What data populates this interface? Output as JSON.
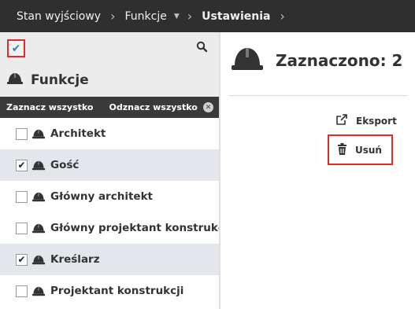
{
  "breadcrumb": {
    "items": [
      "Stan wyjściowy",
      "Funkcje",
      "Ustawienia"
    ]
  },
  "left_panel": {
    "title": "Funkcje",
    "select_all": "Zaznacz wszystko",
    "deselect_all": "Odznacz wszystko",
    "items": [
      {
        "label": "Architekt",
        "checked": false
      },
      {
        "label": "Gość",
        "checked": true
      },
      {
        "label": "Główny architekt",
        "checked": false
      },
      {
        "label": "Główny projektant konstrukcji",
        "checked": false
      },
      {
        "label": "Kreślarz",
        "checked": true
      },
      {
        "label": "Projektant konstrukcji",
        "checked": false
      }
    ]
  },
  "right_panel": {
    "title": "Zaznaczono: 2",
    "actions": {
      "export": "Eksport",
      "delete": "Usuń"
    }
  },
  "colors": {
    "topbar": "#2f2f2f",
    "highlight_border": "#e02b2b",
    "check_accent": "#3d7ac7",
    "row_alt": "#e3e7eb"
  }
}
